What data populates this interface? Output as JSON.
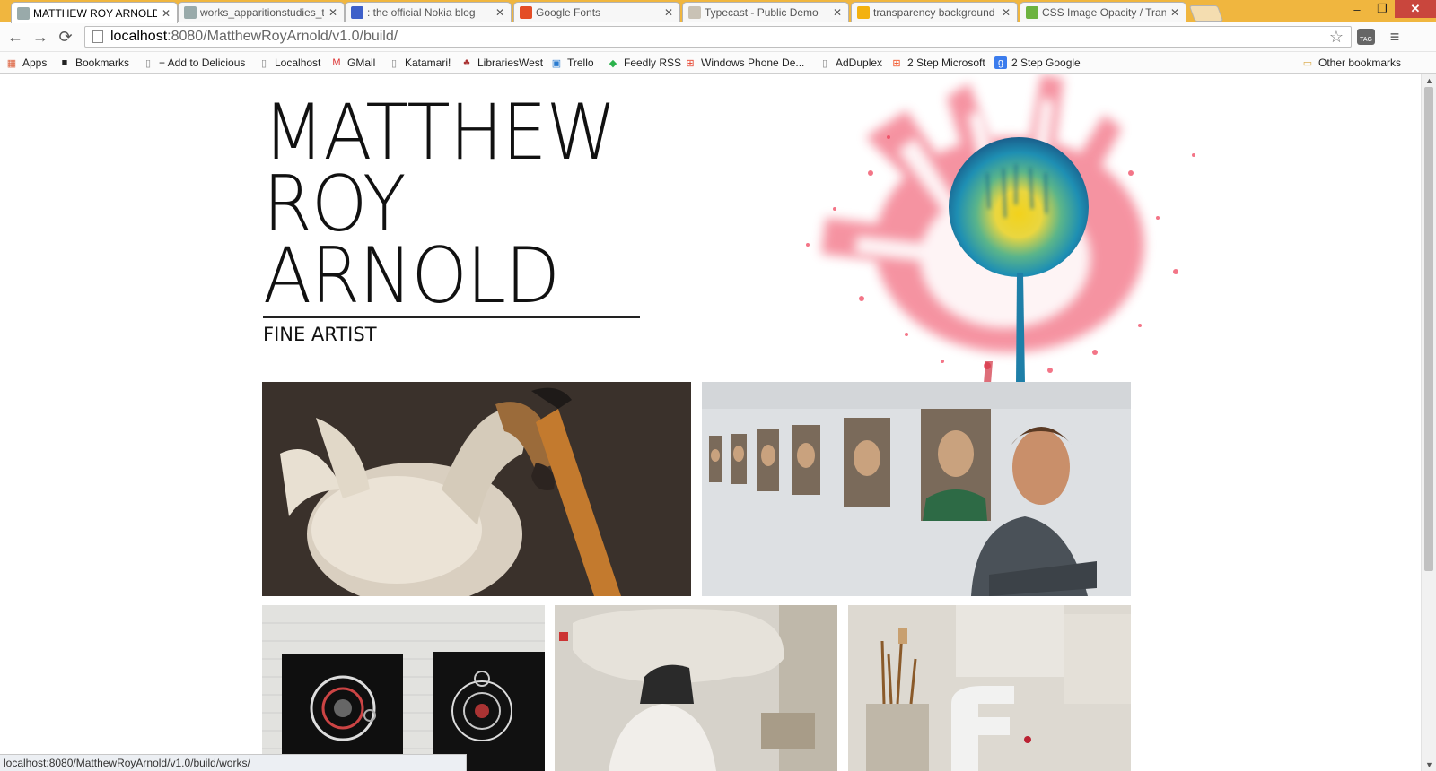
{
  "browser": {
    "tabs": [
      {
        "title": "MATTHEW ROY ARNOLD",
        "active": true,
        "favicon": "page-icon",
        "color": "#9aa"
      },
      {
        "title": "works_apparitionstudies_t",
        "active": false,
        "favicon": "page-icon",
        "color": "#9aa"
      },
      {
        "title": ": the official Nokia blog",
        "active": false,
        "favicon": "nokia-icon",
        "color": "#3d5fc9"
      },
      {
        "title": "Google Fonts",
        "active": false,
        "favicon": "google-fonts-icon",
        "color": "#e44d26"
      },
      {
        "title": "Typecast - Public Demo",
        "active": false,
        "favicon": "typecast-icon",
        "color": "#c9c2b5"
      },
      {
        "title": "transparency background",
        "active": false,
        "favicon": "bing-icon",
        "color": "#f3b10f"
      },
      {
        "title": "CSS Image Opacity / Tran",
        "active": false,
        "favicon": "w3schools-icon",
        "color": "#6db33f"
      }
    ],
    "close_glyph": "✕",
    "window_controls": {
      "minimize": "–",
      "restore": "❐",
      "close": "✕"
    },
    "nav": {
      "back": "←",
      "forward": "→",
      "reload": "⟳"
    },
    "url": {
      "host": "localhost",
      "path": ":8080/MatthewRoyArnold/v1.0/build/"
    },
    "star_glyph": "☆",
    "ext_label": "TAG",
    "menu_glyph": "≡",
    "bookmarks": [
      {
        "label": "Apps",
        "icon": "apps-grid-icon",
        "glyph": "▦",
        "color": "#d64"
      },
      {
        "label": "Bookmarks",
        "icon": "delicious-icon",
        "glyph": "■",
        "color": "#222"
      },
      {
        "label": "+ Add to Delicious",
        "icon": "page-icon",
        "glyph": "▯",
        "color": "#888"
      },
      {
        "label": "Localhost",
        "icon": "page-icon",
        "glyph": "▯",
        "color": "#888"
      },
      {
        "label": "GMail",
        "icon": "gmail-icon",
        "glyph": "M",
        "color": "#d33"
      },
      {
        "label": "Katamari!",
        "icon": "page-icon",
        "glyph": "▯",
        "color": "#888"
      },
      {
        "label": "LibrariesWest",
        "icon": "libraries-west-icon",
        "glyph": "♣",
        "color": "#a33"
      },
      {
        "label": "Trello",
        "icon": "trello-icon",
        "glyph": "▣",
        "color": "#2a7bd0"
      },
      {
        "label": "Feedly RSS",
        "icon": "feedly-icon",
        "glyph": "◆",
        "color": "#2bb24c"
      },
      {
        "label": "Windows Phone De...",
        "icon": "windows-icon",
        "glyph": "⊞",
        "color": "#e7432e"
      },
      {
        "label": "AdDuplex",
        "icon": "page-icon",
        "glyph": "▯",
        "color": "#888"
      },
      {
        "label": "2 Step Microsoft",
        "icon": "microsoft-icon",
        "glyph": "⊞",
        "color": "#f25022"
      },
      {
        "label": "2 Step Google",
        "icon": "google-icon",
        "glyph": "g",
        "color": "#fff"
      }
    ],
    "other_bookmarks": "Other bookmarks",
    "status_text": "localhost:8080/MatthewRoyArnold/v1.0/build/works/"
  },
  "page": {
    "name_lines": [
      "MATTHEW",
      "ROY",
      "ARNOLD"
    ],
    "subtitle": "FINE ARTIST",
    "colors": {
      "splat_red": "#ee3b55",
      "splat_blue": "#1e8fb3",
      "splat_yellow": "#f2d21c"
    }
  },
  "gallery": [
    {
      "name": "dodo-sculpture-image"
    },
    {
      "name": "artist-portrait-gallery-image"
    },
    {
      "name": "circle-prints-image"
    },
    {
      "name": "plaster-cast-image"
    },
    {
      "name": "studio-brushes-image"
    }
  ]
}
